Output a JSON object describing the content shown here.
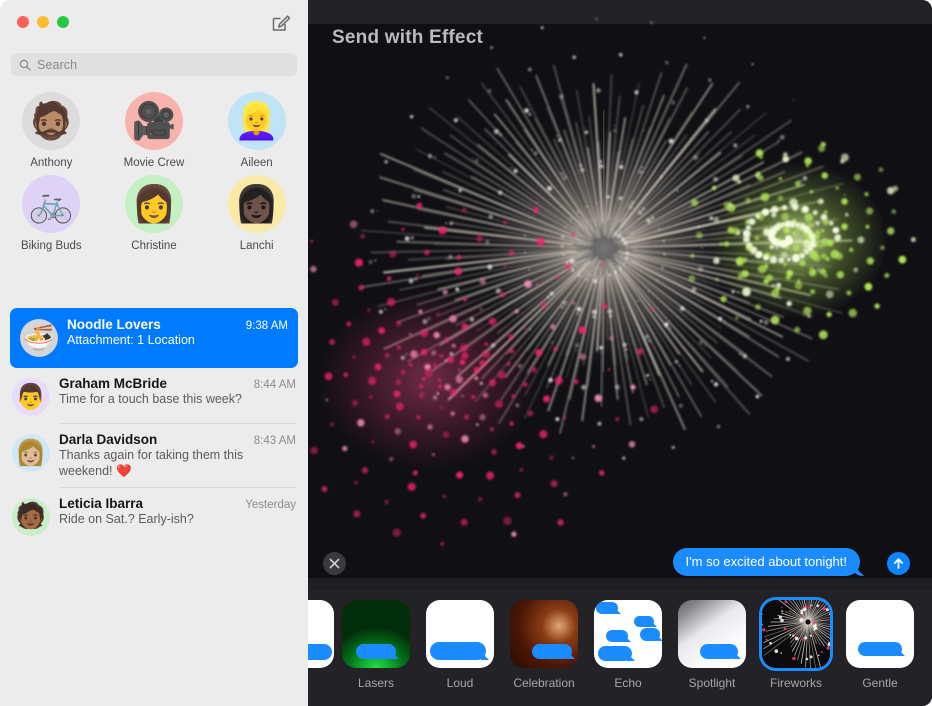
{
  "window": {
    "traffic_lights": [
      {
        "name": "close",
        "color": "#ff5f57"
      },
      {
        "name": "minimize",
        "color": "#febc2e"
      },
      {
        "name": "zoom",
        "color": "#28c840"
      }
    ]
  },
  "sidebar": {
    "compose_icon": "compose-pencil-square-icon",
    "search": {
      "icon": "search-icon",
      "placeholder": "Search",
      "value": ""
    },
    "pinned": [
      {
        "name": "Anthony",
        "avatar": "🧔🏽",
        "bg": "#dcdcdd"
      },
      {
        "name": "Movie Crew",
        "avatar": "🎥",
        "bg": "#f7b3ac"
      },
      {
        "name": "Aileen",
        "avatar": "👱‍♀️",
        "bg": "#bfe4f6"
      },
      {
        "name": "Biking Buds",
        "avatar": "🚲",
        "bg": "#ded2f7"
      },
      {
        "name": "Christine",
        "avatar": "👩",
        "bg": "#c4f0c4"
      },
      {
        "name": "Lanchi",
        "avatar": "👩🏿",
        "bg": "#fbe9a8"
      }
    ],
    "conversations": [
      {
        "name": "Noodle Lovers",
        "time": "9:38 AM",
        "preview": "Attachment: 1 Location",
        "avatar": "🍜",
        "bg": "#d5d5d7",
        "selected": true
      },
      {
        "name": "Graham McBride",
        "time": "8:44 AM",
        "preview": "Time for a touch base this week?",
        "avatar": "👨",
        "bg": "#e7dcfb",
        "selected": false
      },
      {
        "name": "Darla Davidson",
        "time": "8:43 AM",
        "preview": "Thanks again for taking them this weekend! ❤️",
        "avatar": "👩🏼",
        "bg": "#cfe8f7",
        "selected": false
      },
      {
        "name": "Leticia Ibarra",
        "time": "Yesterday",
        "preview": "Ride on Sat.? Early-ish?",
        "avatar": "🧑🏾",
        "bg": "#c9eec9",
        "selected": false
      }
    ]
  },
  "main": {
    "title": "Send with Effect",
    "close_icon": "close-x-icon",
    "send_icon": "send-arrow-up-icon",
    "message_bubble": "I'm so excited about tonight!",
    "accent_color": "#1b8cff",
    "effects": [
      {
        "label": "",
        "style": "white",
        "clipped": true,
        "selected": false
      },
      {
        "label": "Lasers",
        "style": "lasers",
        "clipped": false,
        "selected": false
      },
      {
        "label": "Loud",
        "style": "loud",
        "clipped": false,
        "selected": false
      },
      {
        "label": "Celebration",
        "style": "celebration",
        "clipped": false,
        "selected": false
      },
      {
        "label": "Echo",
        "style": "echo",
        "clipped": false,
        "selected": false
      },
      {
        "label": "Spotlight",
        "style": "spotlight",
        "clipped": false,
        "selected": false
      },
      {
        "label": "Fireworks",
        "style": "fireworks",
        "clipped": false,
        "selected": true
      },
      {
        "label": "Gentle",
        "style": "gentle",
        "clipped": false,
        "selected": false
      }
    ]
  }
}
